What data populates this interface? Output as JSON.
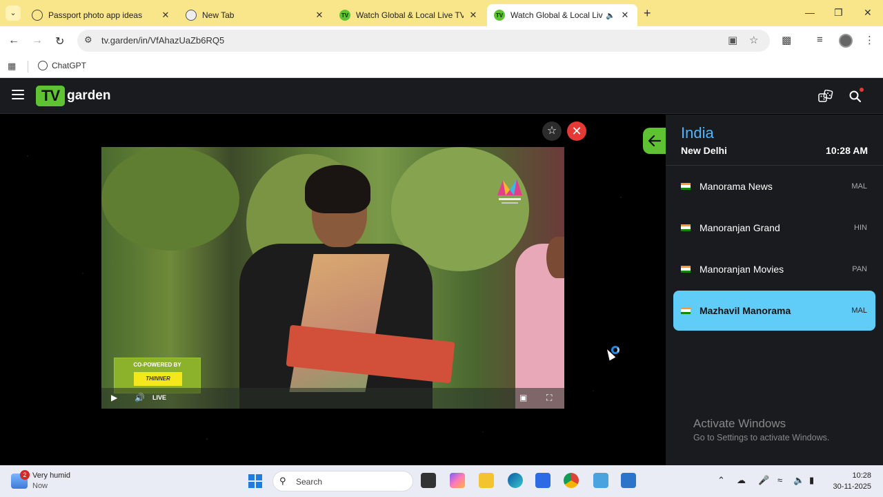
{
  "browser": {
    "tabs": [
      {
        "title": "Passport photo app ideas",
        "favicon": "chatgpt-icon"
      },
      {
        "title": "New Tab",
        "favicon": "chrome-icon"
      },
      {
        "title": "Watch Global & Local Live TV C",
        "favicon": "tv-garden-icon"
      },
      {
        "title": "Watch Global & Local Live T",
        "favicon": "tv-garden-icon",
        "active": true,
        "audio": true
      }
    ],
    "url": "tv.garden/in/VfAhazUaZb6RQ5",
    "bookmarks": [
      {
        "label": "ChatGPT"
      }
    ]
  },
  "site": {
    "logo_tv": "TV",
    "logo_garden": "garden"
  },
  "player": {
    "sponsor_top": "CO-POWERED BY",
    "sponsor_logo": "THINNER",
    "live_label": "LIVE"
  },
  "panel": {
    "country": "India",
    "city": "New Delhi",
    "time": "10:28 AM",
    "channels": [
      {
        "name": "Manorama News",
        "lang": "MAL"
      },
      {
        "name": "Manoranjan Grand",
        "lang": "HIN"
      },
      {
        "name": "Manoranjan Movies",
        "lang": "PAN"
      },
      {
        "name": "Mazhavil Manorama",
        "lang": "MAL",
        "active": true
      }
    ]
  },
  "watermark": {
    "title": "Activate Windows",
    "subtitle": "Go to Settings to activate Windows."
  },
  "taskbar": {
    "weather_badge": "2",
    "weather_text": "Very humid",
    "weather_sub": "Now",
    "search_label": "Search",
    "clock_time": "10:28",
    "clock_date": "30-11-2025"
  },
  "colors": {
    "accent_green": "#5ec232",
    "accent_blue": "#4db6ff",
    "active_channel": "#5fcdf7",
    "close_red": "#e53935"
  }
}
